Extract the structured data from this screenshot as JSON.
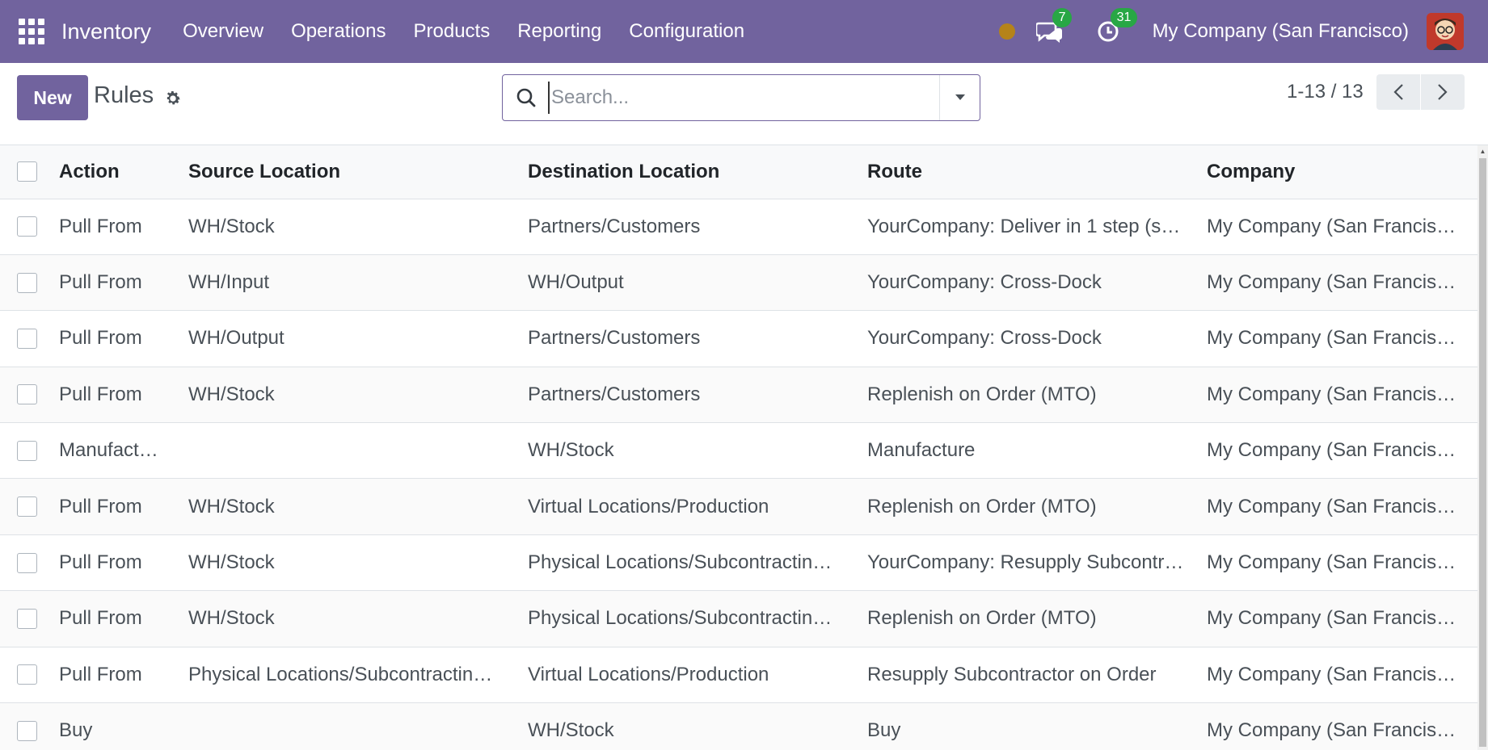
{
  "navbar": {
    "app_name": "Inventory",
    "menu": [
      "Overview",
      "Operations",
      "Products",
      "Reporting",
      "Configuration"
    ],
    "messages_count": "7",
    "activities_count": "31",
    "company": "My Company (San Francisco)",
    "accent_color": "#71639e"
  },
  "control": {
    "new_label": "New",
    "title": "Rules",
    "search_placeholder": "Search...",
    "pager": "1-13 / 13"
  },
  "table": {
    "columns": [
      "Action",
      "Source Location",
      "Destination Location",
      "Route",
      "Company"
    ],
    "rows": [
      [
        "Pull From",
        "WH/Stock",
        "Partners/Customers",
        "YourCompany: Deliver in 1 step (s…",
        "My Company (San Francis…"
      ],
      [
        "Pull From",
        "WH/Input",
        "WH/Output",
        "YourCompany: Cross-Dock",
        "My Company (San Francis…"
      ],
      [
        "Pull From",
        "WH/Output",
        "Partners/Customers",
        "YourCompany: Cross-Dock",
        "My Company (San Francis…"
      ],
      [
        "Pull From",
        "WH/Stock",
        "Partners/Customers",
        "Replenish on Order (MTO)",
        "My Company (San Francis…"
      ],
      [
        "Manufact…",
        "",
        "WH/Stock",
        "Manufacture",
        "My Company (San Francis…"
      ],
      [
        "Pull From",
        "WH/Stock",
        "Virtual Locations/Production",
        "Replenish on Order (MTO)",
        "My Company (San Francis…"
      ],
      [
        "Pull From",
        "WH/Stock",
        "Physical Locations/Subcontractin…",
        "YourCompany: Resupply Subcontr…",
        "My Company (San Francis…"
      ],
      [
        "Pull From",
        "WH/Stock",
        "Physical Locations/Subcontractin…",
        "Replenish on Order (MTO)",
        "My Company (San Francis…"
      ],
      [
        "Pull From",
        "Physical Locations/Subcontractin…",
        "Virtual Locations/Production",
        "Resupply Subcontractor on Order",
        "My Company (San Francis…"
      ],
      [
        "Buy",
        "",
        "WH/Stock",
        "Buy",
        "My Company (San Francis…"
      ]
    ]
  }
}
